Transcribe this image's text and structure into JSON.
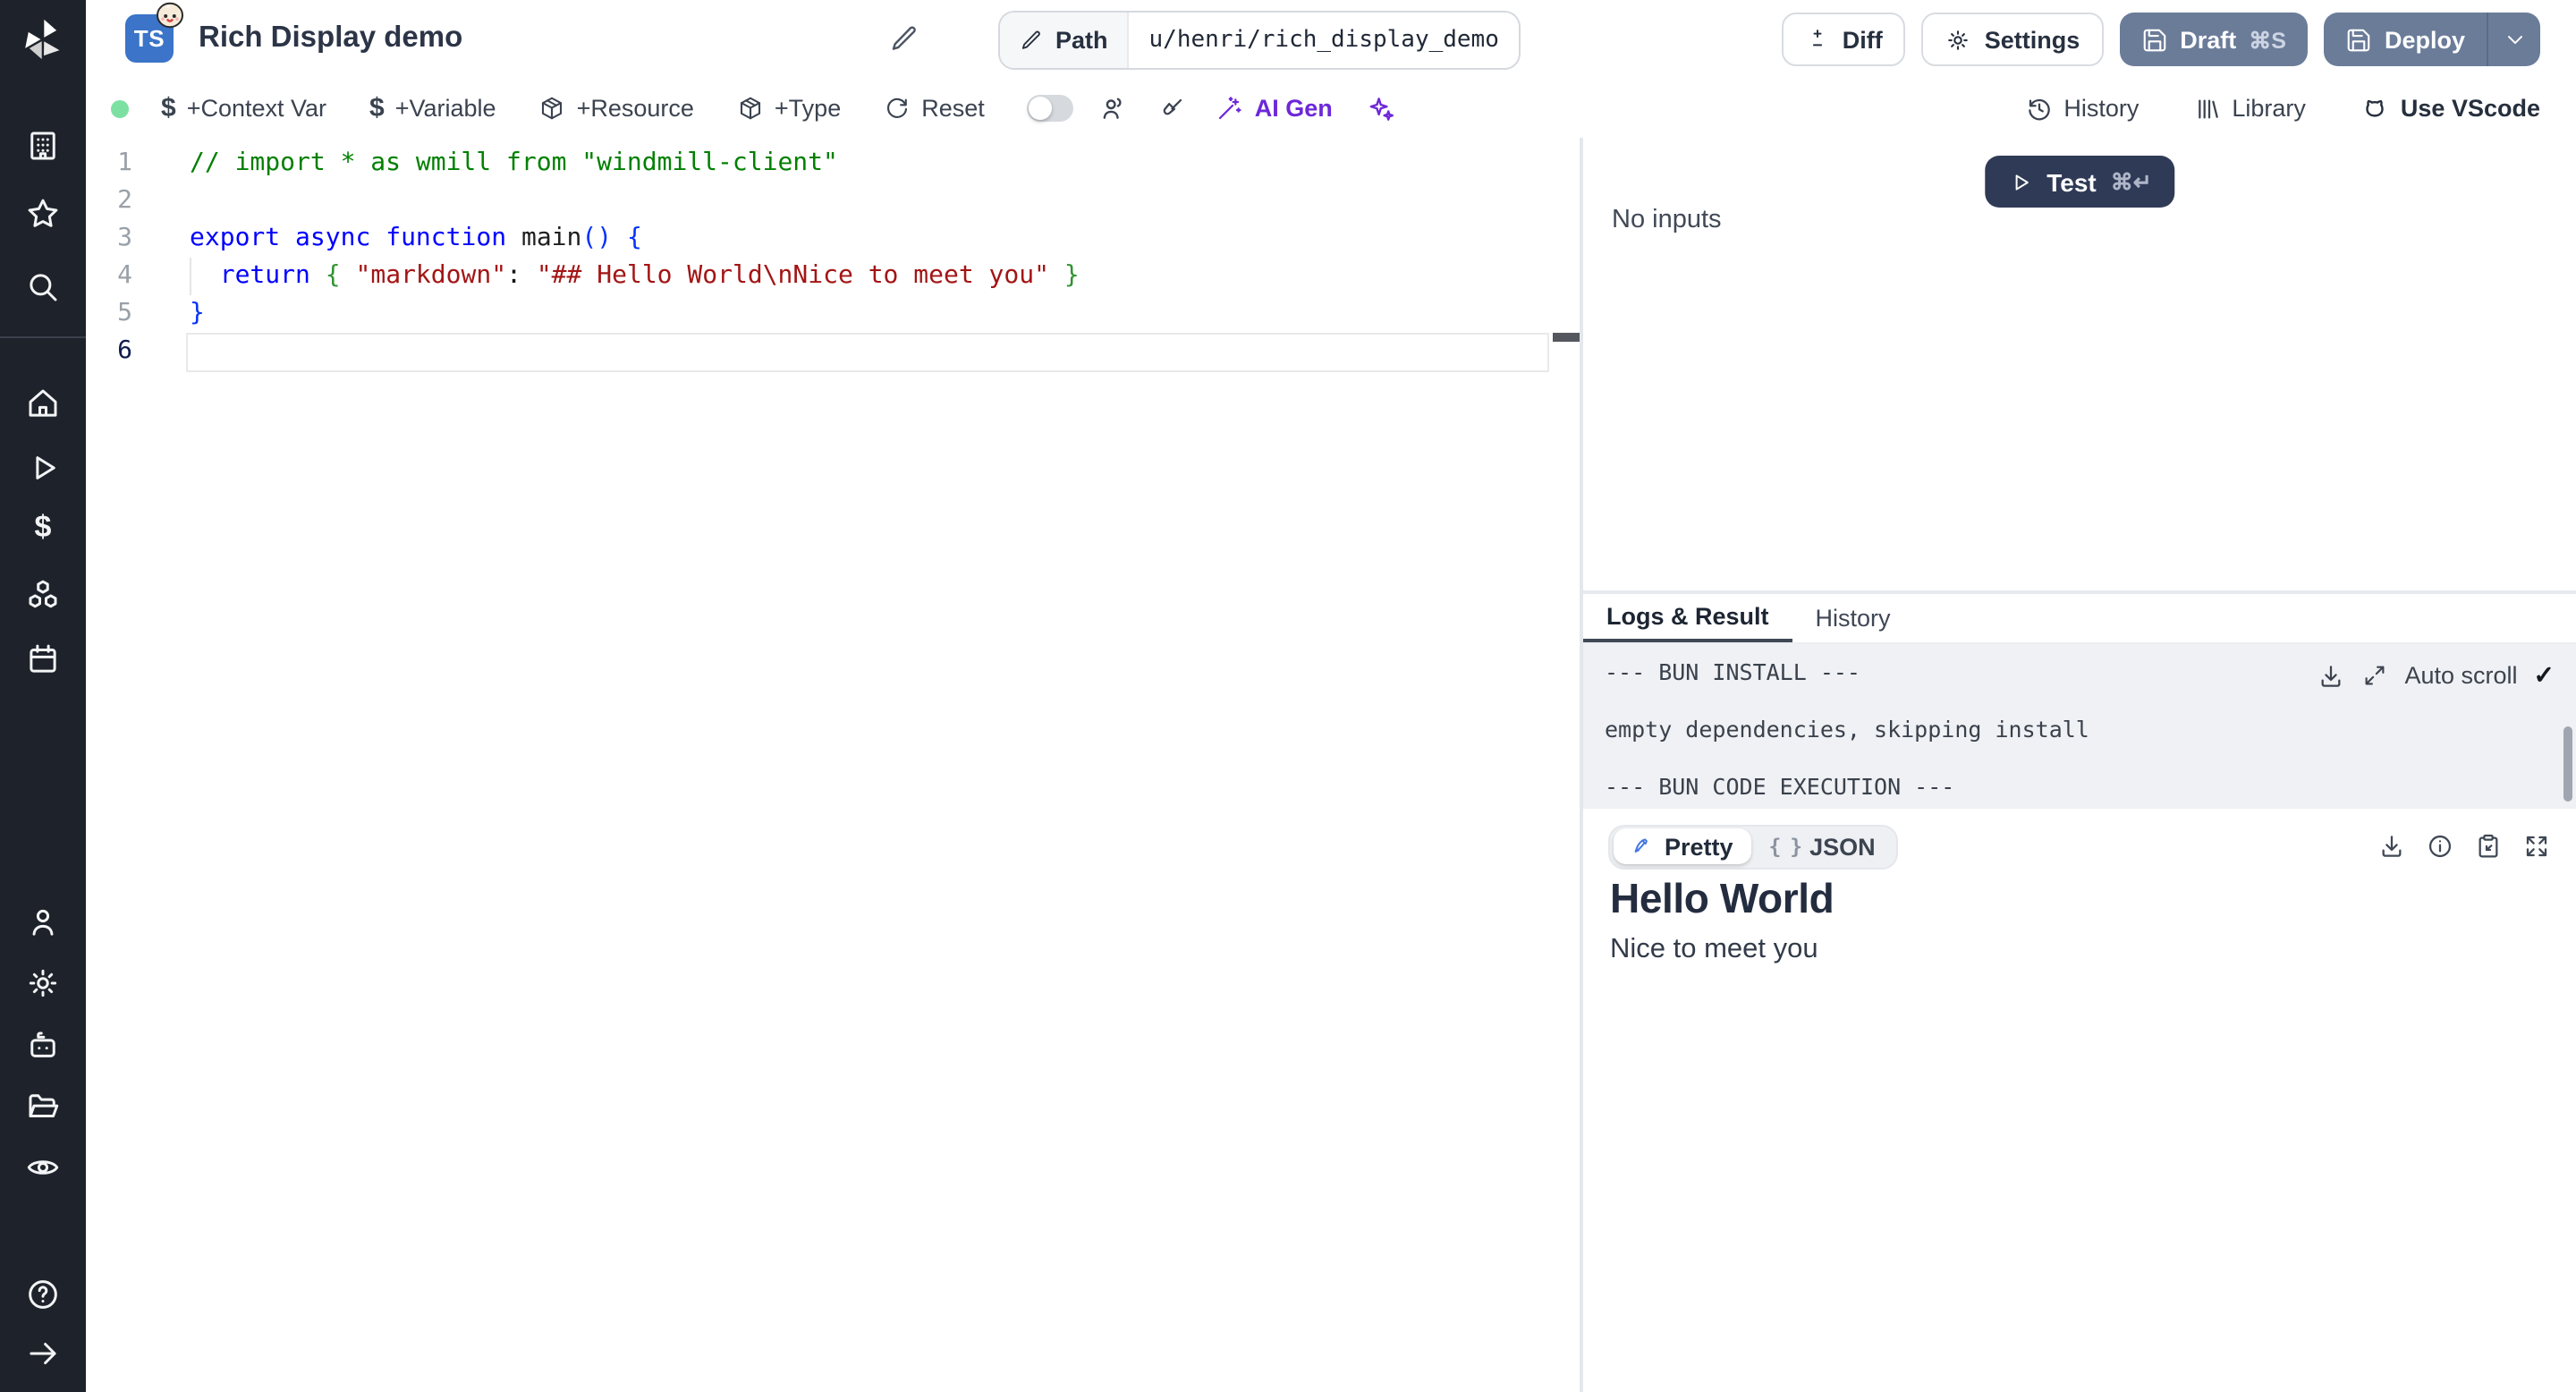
{
  "sidebar": {
    "items": [
      "workspace",
      "favorites",
      "search",
      "home",
      "runs",
      "variables",
      "resources",
      "schedules",
      "users",
      "settings",
      "workers",
      "folders",
      "audit-logs",
      "help",
      "expand"
    ]
  },
  "header": {
    "title": "Rich Display demo",
    "language_badge": "TS",
    "path": {
      "label": "Path",
      "value": "u/henri/rich_display_demo"
    },
    "actions": {
      "diff": "Diff",
      "settings": "Settings",
      "draft": "Draft",
      "draft_shortcut": "⌘S",
      "deploy": "Deploy"
    }
  },
  "toolbar": {
    "context_var": "+Context Var",
    "variable": "+Variable",
    "resource": "+Resource",
    "type": "+Type",
    "reset": "Reset",
    "ai_gen": "AI Gen",
    "right": {
      "history": "History",
      "library": "Library",
      "vscode": "Use VScode"
    }
  },
  "editor": {
    "lines": [
      {
        "n": 1,
        "tokens": [
          [
            "comment",
            "// import * as wmill from \"windmill-client\""
          ]
        ]
      },
      {
        "n": 2,
        "tokens": []
      },
      {
        "n": 3,
        "tokens": [
          [
            "kw",
            "export"
          ],
          [
            "pl",
            " "
          ],
          [
            "kw",
            "async"
          ],
          [
            "pl",
            " "
          ],
          [
            "kw",
            "function"
          ],
          [
            "pl",
            " "
          ],
          [
            "fn",
            "main"
          ],
          [
            "b1",
            "()"
          ],
          [
            "pl",
            " "
          ],
          [
            "b1",
            "{"
          ]
        ]
      },
      {
        "n": 4,
        "tokens": [
          [
            "pl",
            "  "
          ],
          [
            "kw",
            "return"
          ],
          [
            "pl",
            " "
          ],
          [
            "b2",
            "{"
          ],
          [
            "pl",
            " "
          ],
          [
            "str",
            "\"markdown\""
          ],
          [
            "pl",
            ": "
          ],
          [
            "str",
            "\"## Hello World"
          ],
          [
            "esc",
            "\\n"
          ],
          [
            "str",
            "Nice to meet you\""
          ],
          [
            "pl",
            " "
          ],
          [
            "b2",
            "}"
          ]
        ]
      },
      {
        "n": 5,
        "tokens": [
          [
            "b1",
            "}"
          ]
        ]
      },
      {
        "n": 6,
        "tokens": [],
        "active": true
      }
    ]
  },
  "inputs_panel": {
    "test_label": "Test",
    "test_shortcut": "⌘↵",
    "empty_text": "No inputs"
  },
  "output_panel": {
    "tabs": [
      {
        "label": "Logs & Result"
      },
      {
        "label": "History"
      }
    ],
    "active_tab": "Logs & Result",
    "logs": [
      "--- BUN INSTALL ---",
      "empty dependencies, skipping install",
      "--- BUN CODE EXECUTION ---"
    ],
    "auto_scroll_label": "Auto scroll",
    "auto_scroll_check": "✓",
    "result": {
      "pretty_label": "Pretty",
      "json_label": "JSON",
      "json_glyph": "{ }",
      "selected_view": "Pretty",
      "heading": "Hello World",
      "body": "Nice to meet you"
    }
  },
  "colors": {
    "accent_purple": "#6d28d9",
    "button_slate": "#6b7c99",
    "button_dark_navy": "#2f3a56",
    "status_green": "#7ce0a3",
    "ts_badge_blue": "#3b74c8",
    "sidebar_bg": "#1e232b"
  }
}
